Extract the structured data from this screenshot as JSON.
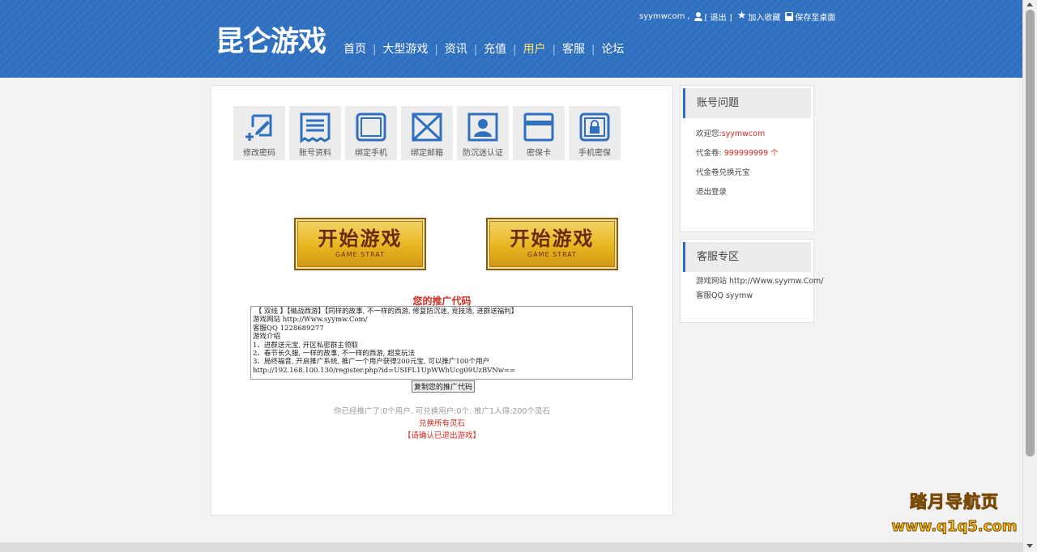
{
  "header": {
    "logo": "昆仑游戏",
    "nav": [
      {
        "label": "首页",
        "active": false
      },
      {
        "label": "大型游戏",
        "active": false
      },
      {
        "label": "资讯",
        "active": false
      },
      {
        "label": "充值",
        "active": false
      },
      {
        "label": "用户",
        "active": true
      },
      {
        "label": "客服",
        "active": false
      },
      {
        "label": "论坛",
        "active": false
      }
    ],
    "username": "syymwcom",
    "username_sep": ",",
    "logout_label": "[ 退出 ]",
    "favorite_label": "加入收藏",
    "save_desktop_label": "保存至桌面",
    "star_glyph": "★"
  },
  "main": {
    "icons": [
      {
        "label": "修改密码",
        "icon": "edit-password-icon"
      },
      {
        "label": "账号资料",
        "icon": "account-info-icon"
      },
      {
        "label": "绑定手机",
        "icon": "phone-icon"
      },
      {
        "label": "绑定邮箱",
        "icon": "mail-icon"
      },
      {
        "label": "防沉迷认证",
        "icon": "id-card-icon"
      },
      {
        "label": "密保卡",
        "icon": "security-card-icon"
      },
      {
        "label": "手机密保",
        "icon": "phone-lock-icon"
      }
    ],
    "start_button_title": "开始游戏",
    "start_button_sub": "GAME STRAT",
    "promo_title": "您的推广代码",
    "promo_text": " 【 双线 】【徵战西游】【同样的故事, 不一样的西游, 修复防沉迷, 竞技场, 进群送福利】\n游戏网站 http://Www.syymw.Com/\n客服QQ 1228689277\n游戏介绍\n1、进群送元宝, 开区私密群主领取\n2、春节长久服, 一样的故事, 不一样的西游, 超变玩法\n3、局终福音, 开启推广系统, 推广一个用户获得200元宝, 可以推广100个用户\nhttp://192.168.100.130/register.php?id=USIFL1UpWWhUcg09UzBVNw==",
    "copy_button": "复制您的推广代码",
    "stats": "你已经推广了:0个用户. 可兑换用户:0个. 推广1人得:200个灵石",
    "exchange_link": "兑换所有灵石",
    "confirm_note": "【请确认已退出游戏】"
  },
  "sidebar": {
    "account": {
      "title": "账号问题",
      "welcome_prefix": "欢迎您:",
      "welcome_user": "syymwcom",
      "voucher_prefix": "代金卷: ",
      "voucher_value": "999999999 个",
      "exchange_label": "代金卷兑换元宝",
      "logout_label": "退出登录"
    },
    "service": {
      "title": "客服专区",
      "website": "游戏网站 http://Www.syymw.Com/",
      "qq": "客服QQ syymw"
    }
  },
  "watermark": {
    "title": "踏月导航页",
    "url": "www.q1q5.com"
  },
  "colors": {
    "header_blue": "#2f6fbf",
    "active_nav": "#ffe86a",
    "alert_red": "#d42b1f",
    "icon_blue": "#2f6fbf",
    "gold": "#e8b520"
  }
}
